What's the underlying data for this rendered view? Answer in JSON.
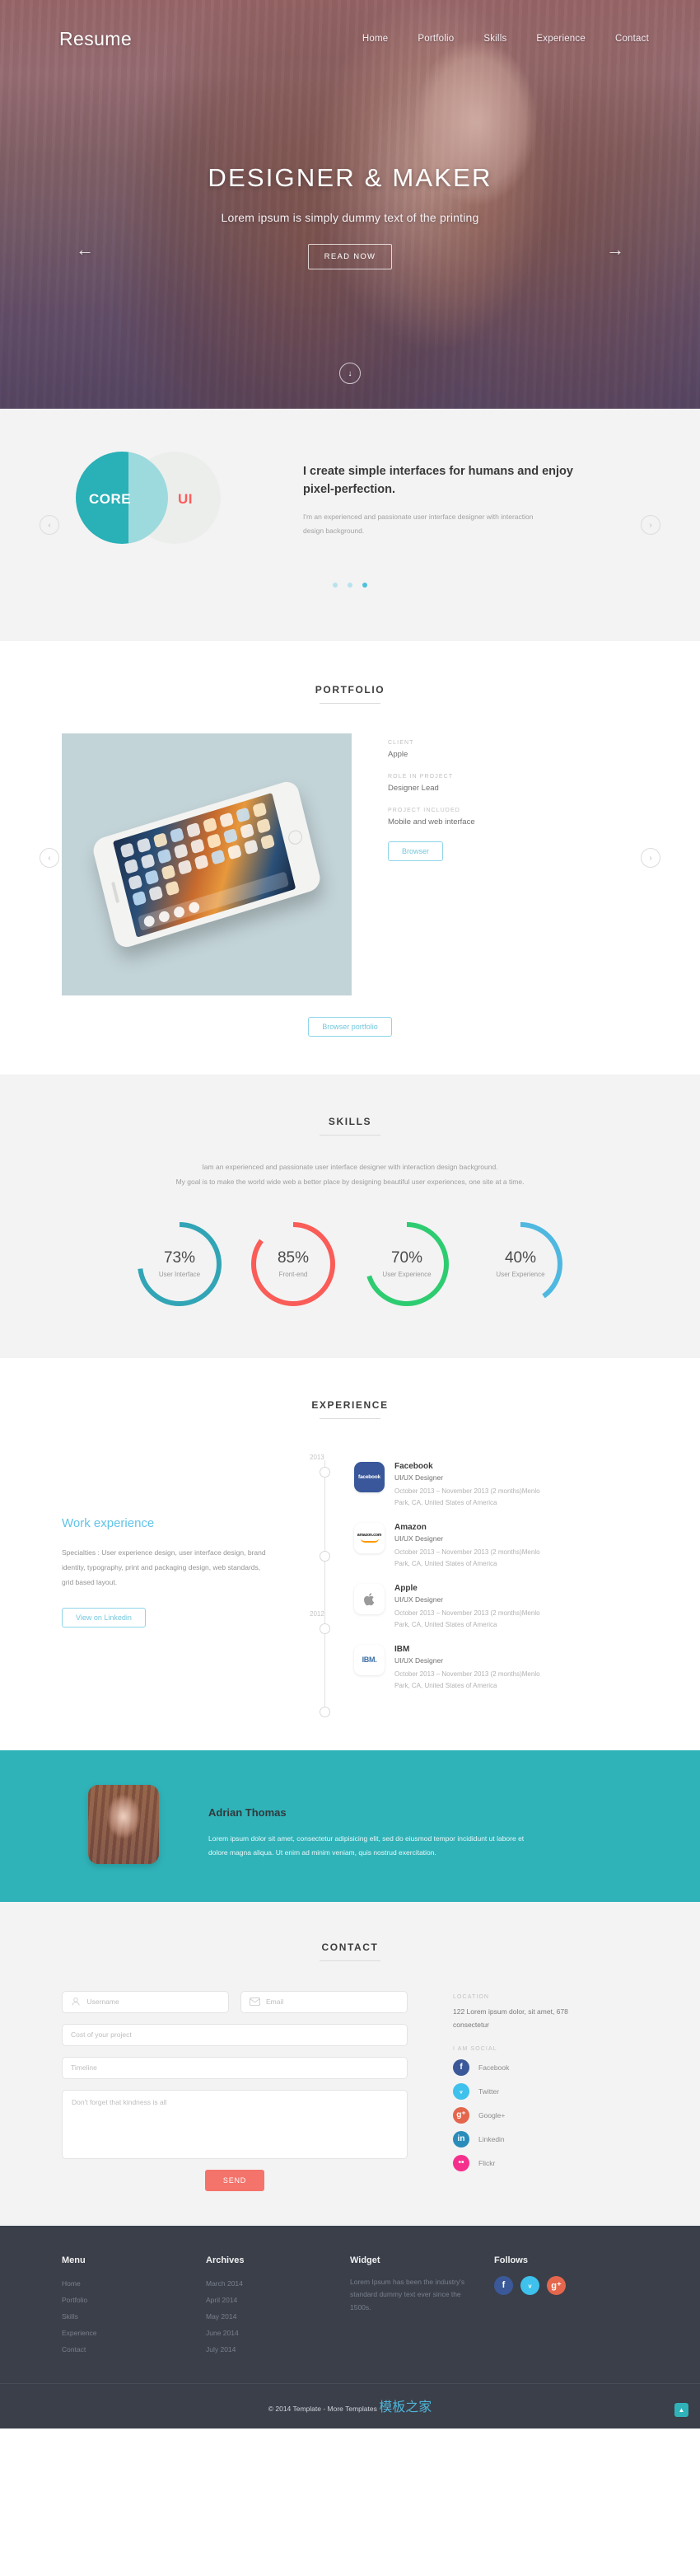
{
  "hero": {
    "brand": "Resume",
    "nav": [
      "Home",
      "Portfolio",
      "Skills",
      "Experience",
      "Contact"
    ],
    "title": "DESIGNER & MAKER",
    "subtitle": "Lorem ipsum is simply dummy text of the printing",
    "button": "READ NOW",
    "arrow_left": "←",
    "arrow_right": "→",
    "scroll_glyph": "↓"
  },
  "intro": {
    "venn_left": "CORE",
    "venn_right": "UI",
    "heading": "I create simple interfaces for humans and enjoy pixel-perfection.",
    "paragraph": "I'm an experienced and passionate user interface designer with interaction design background.",
    "arrow_left": "‹",
    "arrow_right": "›"
  },
  "portfolio": {
    "title": "PORTFOLIO",
    "fields": [
      {
        "label": "CLIENT",
        "value": "Apple"
      },
      {
        "label": "ROLE IN PROJECT",
        "value": "Designer Lead"
      },
      {
        "label": "PROJECT INCLUDED",
        "value": "Mobile and web interface"
      }
    ],
    "browser_button": "Browser",
    "browse_all_button": "Browser portfolio",
    "arrow_left": "‹",
    "arrow_right": "›"
  },
  "skills": {
    "title": "SKILLS",
    "paragraph_line1": "Iam an experienced and passionate user interface designer with interaction design background.",
    "paragraph_line2": "My goal is to make the world wide web a better place by designing beautiful user experiences, one site at a time."
  },
  "chart_data": {
    "type": "pie",
    "title": "SKILLS",
    "categories": [
      "User Interface",
      "Front-end",
      "User Experience",
      "User Experience"
    ],
    "values": [
      73,
      85,
      70,
      40
    ],
    "labels": [
      "73%",
      "85%",
      "70%",
      "40%"
    ],
    "colors": [
      "#31a5b5",
      "#fa5c57",
      "#2ecc71",
      "#4fb8e0"
    ],
    "ylim": [
      0,
      100
    ]
  },
  "experience": {
    "title": "EXPERIENCE",
    "heading": "Work experience",
    "paragraph": "Specialties : User experience design, user interface design, brand identity, typography, print and packaging design, web standards, grid based layout.",
    "button": "View on Linkedin",
    "years": [
      "2013",
      "2012"
    ],
    "items": [
      {
        "logo": "facebook-logo",
        "logo_text": "facebook",
        "company": "Facebook",
        "role": "UI/UX Designer",
        "meta": "October 2013 – November 2013 (2 months)Menlo Park, CA, United States of America"
      },
      {
        "logo": "amazon-logo",
        "logo_text": "amazon.com",
        "company": "Amazon",
        "role": "UI/UX Designer",
        "meta": "October 2013 – November 2013 (2 months)Menlo Park, CA, United States of America"
      },
      {
        "logo": "apple-logo",
        "logo_text": "",
        "company": "Apple",
        "role": "UI/UX Designer",
        "meta": "October 2013 – November 2013 (2 months)Menlo Park, CA, United States of America"
      },
      {
        "logo": "ibm-logo",
        "logo_text": "IBM.",
        "company": "IBM",
        "role": "UI/UX Designer",
        "meta": "October 2013 – November 2013 (2 months)Menlo Park, CA, United States of America"
      }
    ]
  },
  "testimonial": {
    "name": "Adrian Thomas",
    "text": "Lorem ipsum dolor sit amet, consectetur adipisicing elit, sed do eiusmod tempor incididunt ut labore et dolore magna aliqua. Ut enim ad minim veniam, quis nostrud exercitation."
  },
  "contact": {
    "title": "CONTACT",
    "username_placeholder": "Username",
    "email_placeholder": "Email",
    "cost_placeholder": "Cost of your project",
    "timeline_placeholder": "Timeline",
    "message_placeholder": "Don't forget that kindness is all",
    "send_button": "SEND",
    "location_label": "LOCATION",
    "address": "122 Lorem ipsum dolor, sit amet, 678 consectetur",
    "social_label": "I AM SOCIAL",
    "socials": [
      {
        "name": "Facebook",
        "glyph": "f",
        "color": "#3b5998"
      },
      {
        "name": "Twitter",
        "glyph": "ᵥ",
        "color": "#3ec1ec"
      },
      {
        "name": "Google+",
        "glyph": "g⁺",
        "color": "#e4664c"
      },
      {
        "name": "Linkedin",
        "glyph": "in",
        "color": "#2a8cba"
      },
      {
        "name": "Flickr",
        "glyph": "••",
        "color": "#f5308c"
      }
    ]
  },
  "footer": {
    "menu_title": "Menu",
    "menu_items": [
      "Home",
      "Portfolio",
      "Skills",
      "Experience",
      "Contact"
    ],
    "archives_title": "Archives",
    "archives_items": [
      "March 2014",
      "April 2014",
      "May 2014",
      "June 2014",
      "July 2014"
    ],
    "widget_title": "Widget",
    "widget_text": "Lorem Ipsum has been the industry's standard dummy text ever since the 1500s.",
    "follows_title": "Follows",
    "follows": [
      {
        "name": "facebook",
        "glyph": "f",
        "color": "#3b5998"
      },
      {
        "name": "twitter",
        "glyph": "ᵥ",
        "color": "#3ec1ec"
      },
      {
        "name": "google-plus",
        "glyph": "g⁺",
        "color": "#e4664c"
      }
    ],
    "copyright": "© 2014 Template - More Templates ",
    "copyright_link": "模板之家",
    "to_top": "▲"
  }
}
